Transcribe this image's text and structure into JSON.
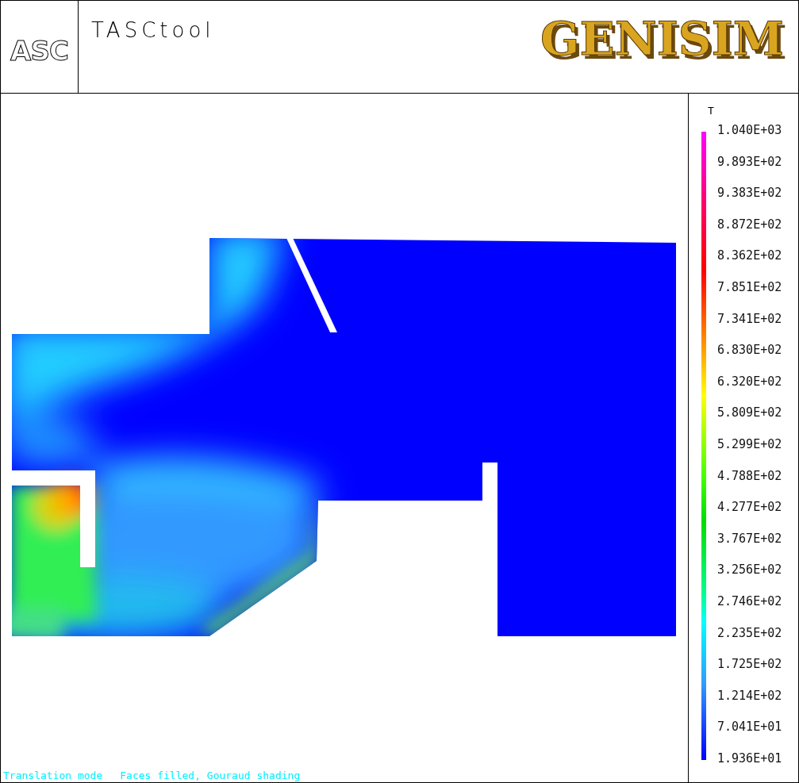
{
  "header": {
    "logo": "ASC",
    "title": "TASCtool",
    "brand": "GENISIM"
  },
  "legend": {
    "variable": "T",
    "labels": [
      "1.040E+03",
      "9.893E+02",
      "9.383E+02",
      "8.872E+02",
      "8.362E+02",
      "7.851E+02",
      "7.341E+02",
      "6.830E+02",
      "6.320E+02",
      "5.809E+02",
      "5.299E+02",
      "4.788E+02",
      "4.277E+02",
      "3.767E+02",
      "3.256E+02",
      "2.746E+02",
      "2.235E+02",
      "1.725E+02",
      "1.214E+02",
      "7.041E+01",
      "1.936E+01"
    ]
  },
  "status_bar": [
    "Translation mode",
    "Faces filled, Gouraud shading"
  ]
}
